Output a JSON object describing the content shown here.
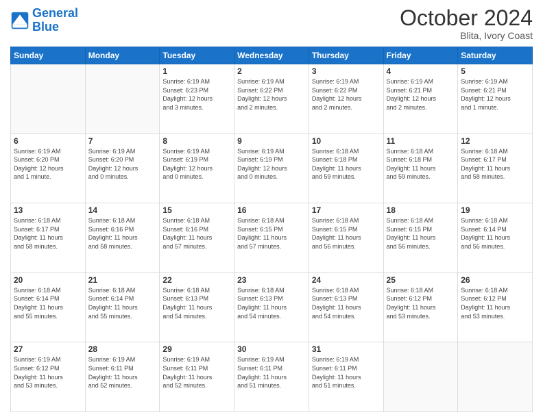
{
  "header": {
    "logo_line1": "General",
    "logo_line2": "Blue",
    "month_title": "October 2024",
    "location": "Blita, Ivory Coast"
  },
  "days_of_week": [
    "Sunday",
    "Monday",
    "Tuesday",
    "Wednesday",
    "Thursday",
    "Friday",
    "Saturday"
  ],
  "weeks": [
    [
      {
        "day": "",
        "info": ""
      },
      {
        "day": "",
        "info": ""
      },
      {
        "day": "1",
        "info": "Sunrise: 6:19 AM\nSunset: 6:23 PM\nDaylight: 12 hours\nand 3 minutes."
      },
      {
        "day": "2",
        "info": "Sunrise: 6:19 AM\nSunset: 6:22 PM\nDaylight: 12 hours\nand 2 minutes."
      },
      {
        "day": "3",
        "info": "Sunrise: 6:19 AM\nSunset: 6:22 PM\nDaylight: 12 hours\nand 2 minutes."
      },
      {
        "day": "4",
        "info": "Sunrise: 6:19 AM\nSunset: 6:21 PM\nDaylight: 12 hours\nand 2 minutes."
      },
      {
        "day": "5",
        "info": "Sunrise: 6:19 AM\nSunset: 6:21 PM\nDaylight: 12 hours\nand 1 minute."
      }
    ],
    [
      {
        "day": "6",
        "info": "Sunrise: 6:19 AM\nSunset: 6:20 PM\nDaylight: 12 hours\nand 1 minute."
      },
      {
        "day": "7",
        "info": "Sunrise: 6:19 AM\nSunset: 6:20 PM\nDaylight: 12 hours\nand 0 minutes."
      },
      {
        "day": "8",
        "info": "Sunrise: 6:19 AM\nSunset: 6:19 PM\nDaylight: 12 hours\nand 0 minutes."
      },
      {
        "day": "9",
        "info": "Sunrise: 6:19 AM\nSunset: 6:19 PM\nDaylight: 12 hours\nand 0 minutes."
      },
      {
        "day": "10",
        "info": "Sunrise: 6:18 AM\nSunset: 6:18 PM\nDaylight: 11 hours\nand 59 minutes."
      },
      {
        "day": "11",
        "info": "Sunrise: 6:18 AM\nSunset: 6:18 PM\nDaylight: 11 hours\nand 59 minutes."
      },
      {
        "day": "12",
        "info": "Sunrise: 6:18 AM\nSunset: 6:17 PM\nDaylight: 11 hours\nand 58 minutes."
      }
    ],
    [
      {
        "day": "13",
        "info": "Sunrise: 6:18 AM\nSunset: 6:17 PM\nDaylight: 11 hours\nand 58 minutes."
      },
      {
        "day": "14",
        "info": "Sunrise: 6:18 AM\nSunset: 6:16 PM\nDaylight: 11 hours\nand 58 minutes."
      },
      {
        "day": "15",
        "info": "Sunrise: 6:18 AM\nSunset: 6:16 PM\nDaylight: 11 hours\nand 57 minutes."
      },
      {
        "day": "16",
        "info": "Sunrise: 6:18 AM\nSunset: 6:15 PM\nDaylight: 11 hours\nand 57 minutes."
      },
      {
        "day": "17",
        "info": "Sunrise: 6:18 AM\nSunset: 6:15 PM\nDaylight: 11 hours\nand 56 minutes."
      },
      {
        "day": "18",
        "info": "Sunrise: 6:18 AM\nSunset: 6:15 PM\nDaylight: 11 hours\nand 56 minutes."
      },
      {
        "day": "19",
        "info": "Sunrise: 6:18 AM\nSunset: 6:14 PM\nDaylight: 11 hours\nand 56 minutes."
      }
    ],
    [
      {
        "day": "20",
        "info": "Sunrise: 6:18 AM\nSunset: 6:14 PM\nDaylight: 11 hours\nand 55 minutes."
      },
      {
        "day": "21",
        "info": "Sunrise: 6:18 AM\nSunset: 6:14 PM\nDaylight: 11 hours\nand 55 minutes."
      },
      {
        "day": "22",
        "info": "Sunrise: 6:18 AM\nSunset: 6:13 PM\nDaylight: 11 hours\nand 54 minutes."
      },
      {
        "day": "23",
        "info": "Sunrise: 6:18 AM\nSunset: 6:13 PM\nDaylight: 11 hours\nand 54 minutes."
      },
      {
        "day": "24",
        "info": "Sunrise: 6:18 AM\nSunset: 6:13 PM\nDaylight: 11 hours\nand 54 minutes."
      },
      {
        "day": "25",
        "info": "Sunrise: 6:18 AM\nSunset: 6:12 PM\nDaylight: 11 hours\nand 53 minutes."
      },
      {
        "day": "26",
        "info": "Sunrise: 6:18 AM\nSunset: 6:12 PM\nDaylight: 11 hours\nand 53 minutes."
      }
    ],
    [
      {
        "day": "27",
        "info": "Sunrise: 6:19 AM\nSunset: 6:12 PM\nDaylight: 11 hours\nand 53 minutes."
      },
      {
        "day": "28",
        "info": "Sunrise: 6:19 AM\nSunset: 6:11 PM\nDaylight: 11 hours\nand 52 minutes."
      },
      {
        "day": "29",
        "info": "Sunrise: 6:19 AM\nSunset: 6:11 PM\nDaylight: 11 hours\nand 52 minutes."
      },
      {
        "day": "30",
        "info": "Sunrise: 6:19 AM\nSunset: 6:11 PM\nDaylight: 11 hours\nand 51 minutes."
      },
      {
        "day": "31",
        "info": "Sunrise: 6:19 AM\nSunset: 6:11 PM\nDaylight: 11 hours\nand 51 minutes."
      },
      {
        "day": "",
        "info": ""
      },
      {
        "day": "",
        "info": ""
      }
    ]
  ]
}
